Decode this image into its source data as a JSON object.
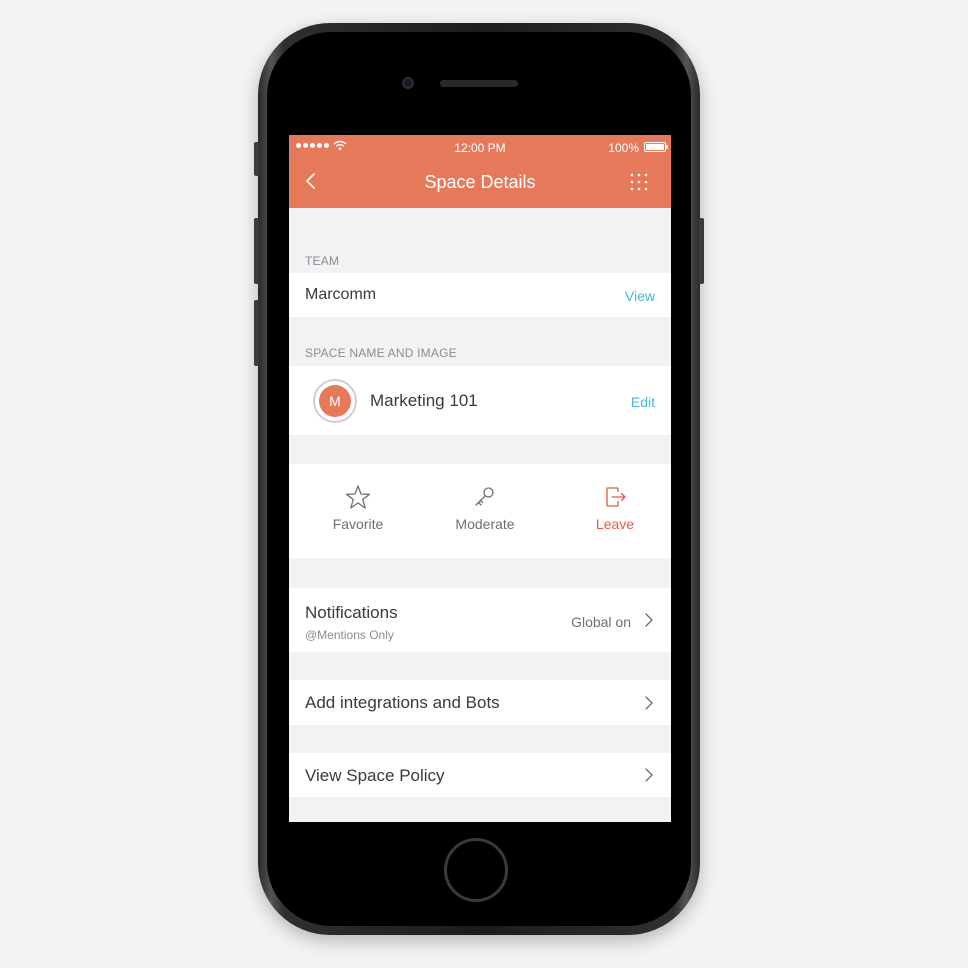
{
  "status_bar": {
    "time": "12:00 PM",
    "battery": "100%"
  },
  "nav": {
    "title": "Space Details"
  },
  "team": {
    "section_label": "TEAM",
    "name": "Marcomm",
    "action_label": "View"
  },
  "space": {
    "section_label": "SPACE NAME AND IMAGE",
    "avatar_initial": "M",
    "name": "Marketing 101",
    "action_label": "Edit"
  },
  "actions": [
    {
      "label": "Favorite",
      "icon": "star-icon"
    },
    {
      "label": "Moderate",
      "icon": "key-icon"
    },
    {
      "label": "Leave",
      "icon": "leave-icon"
    }
  ],
  "notifications": {
    "title": "Notifications",
    "subtitle": "@Mentions Only",
    "value": "Global on"
  },
  "integrations": {
    "title": "Add integrations and Bots"
  },
  "policy": {
    "title": "View Space Policy"
  },
  "colors": {
    "accent": "#e7795b",
    "link": "#49b6da",
    "danger": "#e25b45",
    "background": "#f2f2f4"
  }
}
